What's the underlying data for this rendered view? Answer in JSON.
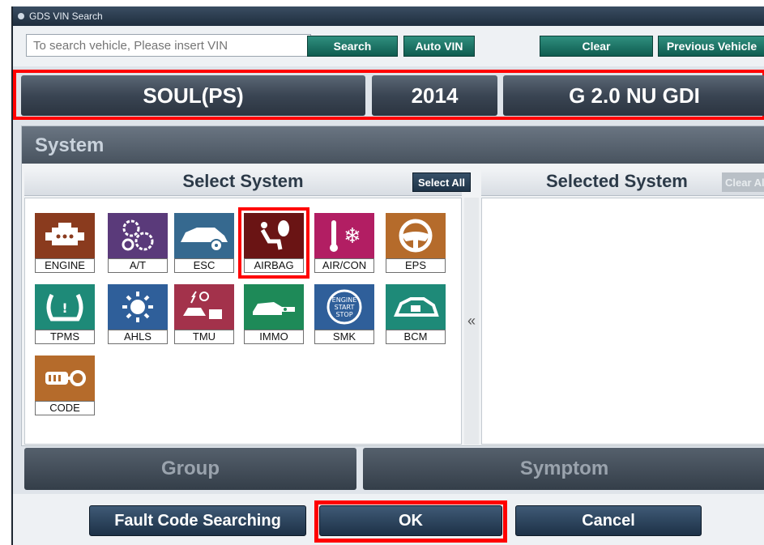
{
  "window": {
    "title": "GDS VIN Search"
  },
  "vin_bar": {
    "placeholder": "To search vehicle, Please insert VIN",
    "search_label": "Search",
    "auto_vin_label": "Auto VIN",
    "clear_label": "Clear",
    "previous_vehicle_label": "Previous Vehicle"
  },
  "vehicle": {
    "model": "SOUL(PS)",
    "year": "2014",
    "engine": "G 2.0 NU GDI"
  },
  "system_panel": {
    "header": "System",
    "select_system_title": "Select System",
    "select_all_label": "Select All",
    "selected_system_title": "Selected System",
    "clear_all_label": "Clear All",
    "divider_arrow": "«",
    "systems": [
      {
        "label": "ENGINE",
        "icon": "engine-icon",
        "color": "#8a3b1e",
        "selected": false
      },
      {
        "label": "A/T",
        "icon": "gears-icon",
        "color": "#5a3a7a",
        "selected": false
      },
      {
        "label": "ESC",
        "icon": "car-esc-icon",
        "color": "#36698f",
        "selected": false
      },
      {
        "label": "AIRBAG",
        "icon": "airbag-icon",
        "color": "#6a1414",
        "selected": true
      },
      {
        "label": "AIR/CON",
        "icon": "aircon-icon",
        "color": "#b21e63",
        "selected": false
      },
      {
        "label": "EPS",
        "icon": "steering-wheel-icon",
        "color": "#b56b2b",
        "selected": false
      },
      {
        "label": "TPMS",
        "icon": "tire-pressure-icon",
        "color": "#1e8a78",
        "selected": false
      },
      {
        "label": "AHLS",
        "icon": "headlamp-icon",
        "color": "#2f5f9a",
        "selected": false
      },
      {
        "label": "TMU",
        "icon": "telematics-icon",
        "color": "#a3324b",
        "selected": false
      },
      {
        "label": "IMMO",
        "icon": "immobilizer-key-icon",
        "color": "#1e8a58",
        "selected": false
      },
      {
        "label": "SMK",
        "icon": "start-stop-icon",
        "color": "#2f5f9a",
        "selected": false
      },
      {
        "label": "BCM",
        "icon": "body-control-icon",
        "color": "#1e8a78",
        "selected": false
      },
      {
        "label": "CODE",
        "icon": "key-code-icon",
        "color": "#b56b2b",
        "selected": false
      }
    ],
    "smk_text": [
      "ENGINE",
      "START",
      "STOP"
    ]
  },
  "group_label": "Group",
  "symptom_label": "Symptom",
  "actions": {
    "fault_code_label": "Fault Code Searching",
    "ok_label": "OK",
    "cancel_label": "Cancel"
  }
}
